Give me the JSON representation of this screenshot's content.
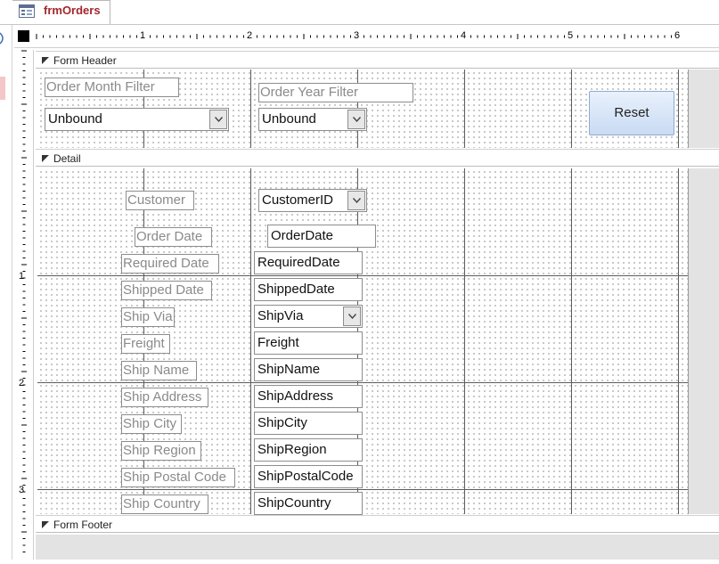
{
  "tab": {
    "title": "frmOrders",
    "icon": "form-icon"
  },
  "ruler": {
    "h_numbers": [
      "1",
      "2",
      "3",
      "4",
      "5",
      "6"
    ],
    "v_numbers": [
      "1",
      "2",
      "3"
    ]
  },
  "sections": {
    "header": "Form Header",
    "detail": "Detail",
    "footer": "Form Footer"
  },
  "header": {
    "month_filter_label": "Order Month Filter",
    "month_filter_value": "Unbound",
    "year_filter_label": "Order Year Filter",
    "year_filter_value": "Unbound",
    "reset_label": "Reset"
  },
  "detail": {
    "fields": [
      {
        "label": "Customer",
        "control": "CustomerID",
        "type": "combo"
      },
      {
        "label": "Order Date",
        "control": "OrderDate",
        "type": "text"
      },
      {
        "label": "Required Date",
        "control": "RequiredDate",
        "type": "text"
      },
      {
        "label": "Shipped Date",
        "control": "ShippedDate",
        "type": "text"
      },
      {
        "label": "Ship Via",
        "control": "ShipVia",
        "type": "combo"
      },
      {
        "label": "Freight",
        "control": "Freight",
        "type": "text"
      },
      {
        "label": "Ship Name",
        "control": "ShipName",
        "type": "text"
      },
      {
        "label": "Ship Address",
        "control": "ShipAddress",
        "type": "text"
      },
      {
        "label": "Ship City",
        "control": "ShipCity",
        "type": "text"
      },
      {
        "label": "Ship Region",
        "control": "ShipRegion",
        "type": "text"
      },
      {
        "label": "Ship Postal Code",
        "control": "ShipPostalCode",
        "type": "text"
      },
      {
        "label": "Ship Country",
        "control": "ShipCountry",
        "type": "text"
      }
    ]
  },
  "colors": {
    "tab_title": "#a4262c",
    "button_top": "#e9f1fc",
    "button_bottom": "#c9dbf3",
    "canvas_gray": "#e3e3e3"
  }
}
